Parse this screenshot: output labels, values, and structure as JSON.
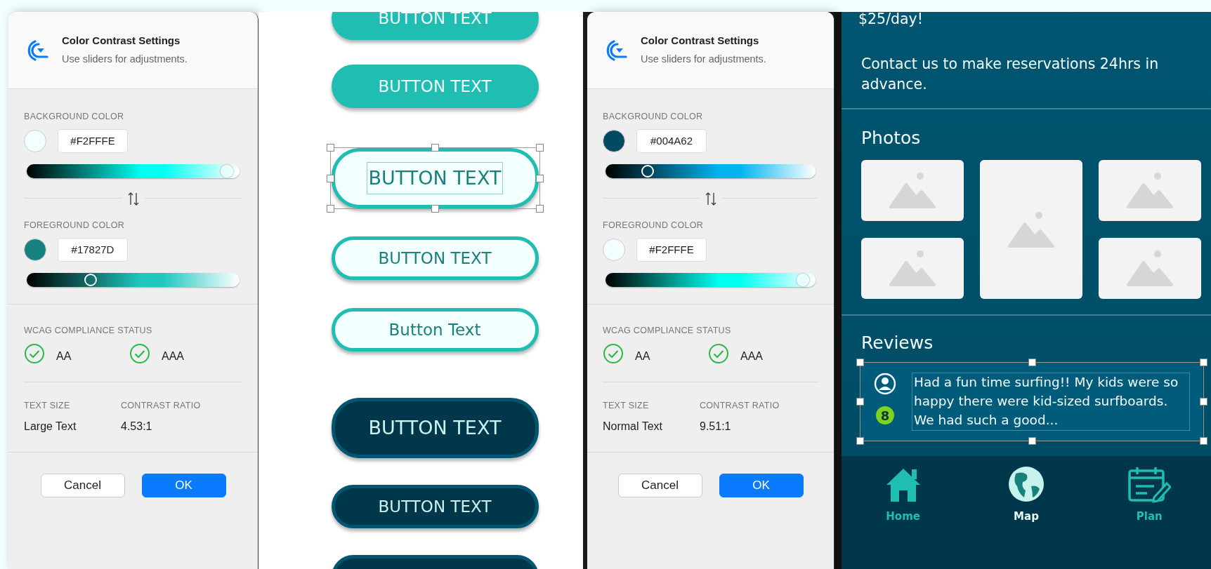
{
  "dialogs": [
    {
      "title": "Color Contrast Settings",
      "subtitle": "Use sliders for adjustments.",
      "background": {
        "label": "BACKGROUND COLOR",
        "color": "#f2fffe",
        "hex": "#F2FFFE",
        "slider": {
          "color": "#00fff0",
          "level": 0.94
        }
      },
      "foreground": {
        "label": "FOREGROUND COLOR",
        "color": "#17827d",
        "hex": "#17827D",
        "slider": {
          "color": "#20c8c0",
          "level": 0.3
        }
      },
      "wcag": {
        "label": "WCAG COMPLIANCE STATUS",
        "checks": [
          {
            "label": "AA",
            "passed": true
          },
          {
            "label": "AAA",
            "passed": true
          }
        ]
      },
      "text_size": {
        "label": "TEXT SIZE",
        "value": "Large Text"
      },
      "contrast_ratio": {
        "label": "CONTRAST RATIO",
        "value": "4.53:1"
      },
      "buttons": [
        {
          "label": "Cancel",
          "kind": "secondary"
        },
        {
          "label": "OK",
          "kind": "primary"
        }
      ]
    },
    {
      "title": "Color Contrast Settings",
      "subtitle": "Use sliders for adjustments.",
      "background": {
        "label": "BACKGROUND COLOR",
        "color": "#004a62",
        "hex": "#004A62",
        "slider": {
          "color": "#00b4f0",
          "level": 0.2
        }
      },
      "foreground": {
        "label": "FOREGROUND COLOR",
        "color": "#f2fffe",
        "hex": "#F2FFFE",
        "slider": {
          "color": "#00fff0",
          "level": 0.94
        }
      },
      "wcag": {
        "label": "WCAG COMPLIANCE STATUS",
        "checks": [
          {
            "label": "AA",
            "passed": true
          },
          {
            "label": "AAA",
            "passed": true
          }
        ]
      },
      "text_size": {
        "label": "TEXT SIZE",
        "value": "Normal Text"
      },
      "contrast_ratio": {
        "label": "CONTRAST RATIO",
        "value": "9.51:1"
      },
      "buttons": [
        {
          "label": "Cancel",
          "kind": "secondary"
        },
        {
          "label": "OK",
          "kind": "primary"
        }
      ]
    }
  ],
  "button_samples": [
    [
      {
        "label": "BUTTON TEXT",
        "kind": "filled",
        "large": false,
        "selected": false
      },
      {
        "label": "BUTTON TEXT",
        "kind": "filled",
        "large": false,
        "selected": false
      }
    ],
    [
      {
        "label": "BUTTON TEXT",
        "kind": "outline",
        "large": true,
        "selected": true
      },
      {
        "label": "BUTTON TEXT",
        "kind": "outline",
        "large": false,
        "selected": false
      },
      {
        "label": "Button Text",
        "kind": "outline",
        "large": false,
        "selected": false
      }
    ],
    [
      {
        "label": "BUTTON TEXT",
        "kind": "dark",
        "large": true,
        "selected": false
      },
      {
        "label": "BUTTON TEXT",
        "kind": "dark",
        "large": false,
        "selected": false
      },
      {
        "kind": "dark",
        "large": false,
        "selected": false
      }
    ]
  ],
  "app": {
    "price_text": "$25/day!",
    "contact_text": "Contact us to make reservations 24hrs in advance.",
    "photos": {
      "title": "Photos"
    },
    "reviews": {
      "title": "Reviews",
      "items": [
        {
          "badge": "8",
          "text": "Had a fun time surfing!! My kids were so happy there were kid-sized surfboards. We had such a good...",
          "selected": true
        }
      ]
    },
    "nav": [
      {
        "label": "Home",
        "kind": "home",
        "selected": false
      },
      {
        "label": "Map",
        "kind": "map",
        "selected": true
      },
      {
        "label": "Plan",
        "kind": "plan",
        "selected": false
      }
    ]
  }
}
